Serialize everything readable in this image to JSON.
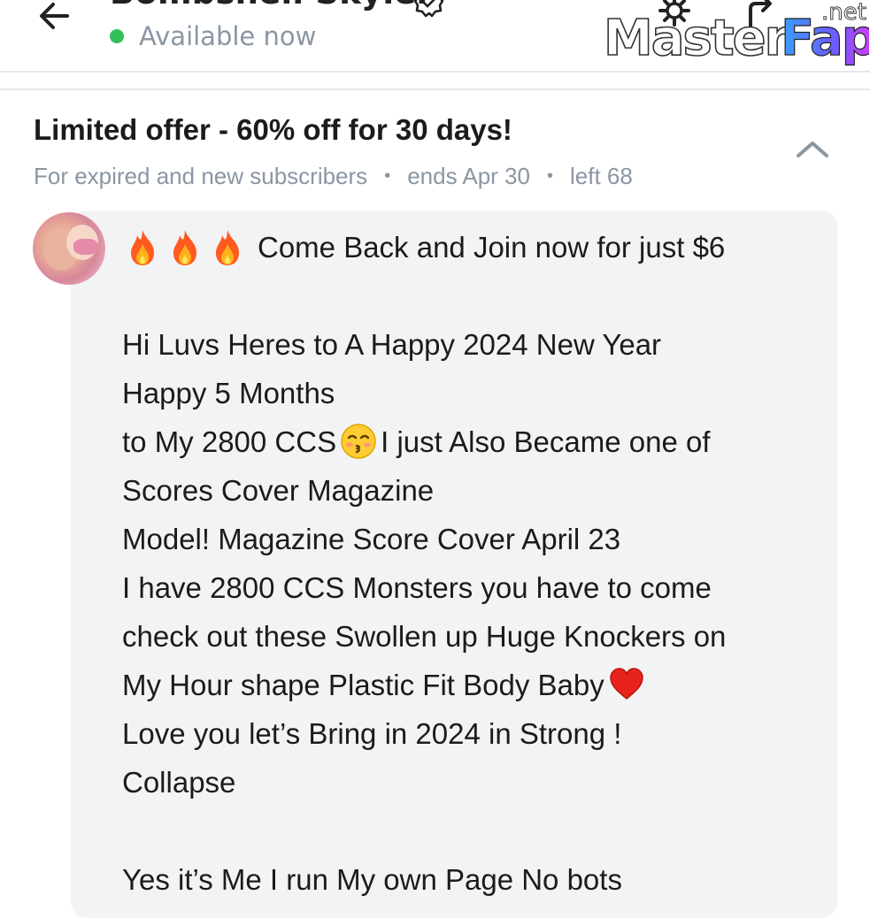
{
  "header": {
    "creator_name": "Bombshell Skyler",
    "status": "Available now",
    "status_color": "#33c05a",
    "icons": [
      "back-arrow-icon",
      "verified-icon",
      "settings-icon",
      "share-icon"
    ]
  },
  "watermark": {
    "text": "MasterFap",
    "suffix": ".net"
  },
  "offer": {
    "title": "Limited offer - 60% off for 30 days!",
    "audience": "For expired and new subscribers",
    "ends": "ends Apr 30",
    "left": "left 68"
  },
  "message": {
    "headline": "Come Back and Join now for just $6",
    "lines": [
      "Hi Luvs Heres to A Happy 2024 New Year",
      "Happy 5 Months",
      "to My 2800 CCS",
      "I just Also Became one of",
      "Scores Cover Magazine",
      "Model! Magazine Score Cover April 23",
      "I have 2800 CCS Monsters you have to come",
      "check out these Swollen up Huge Knockers on",
      "My Hour shape Plastic Fit Body Baby",
      "Love you let’s Bring in 2024 in Strong !",
      "Collapse",
      "Yes it’s Me I run My own Page No bots"
    ]
  },
  "colors": {
    "muted_text": "#8a96a3",
    "bubble_bg": "#f2f3f5",
    "divider": "#e4e6e8"
  }
}
